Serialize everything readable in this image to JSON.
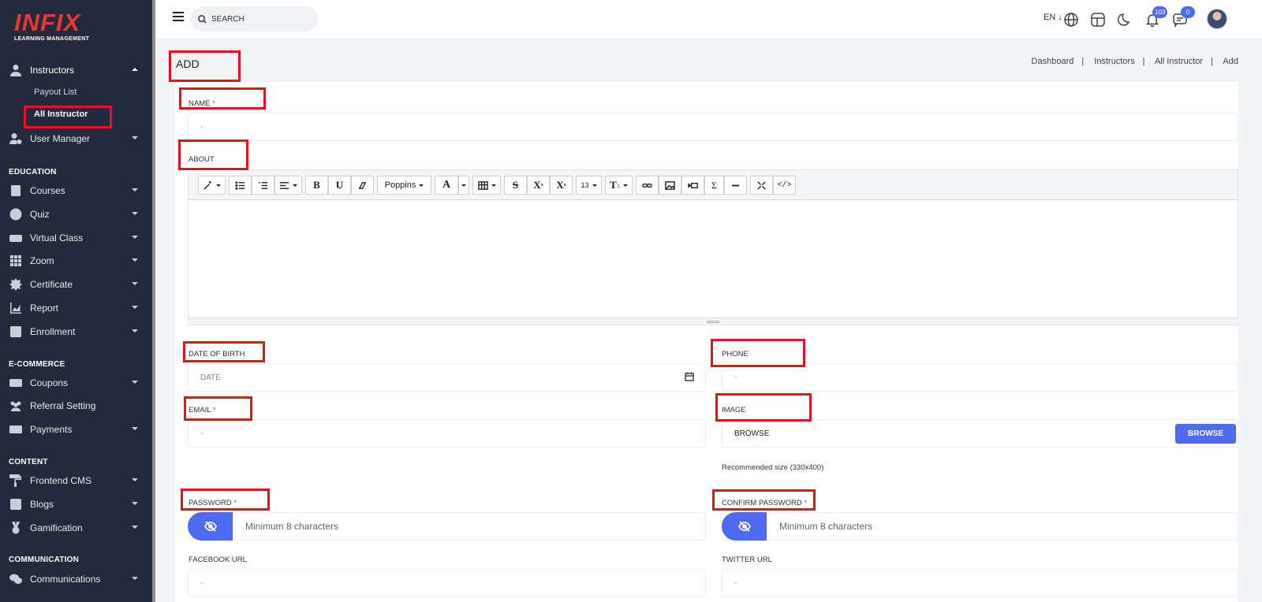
{
  "brand": {
    "logo": "INFIX",
    "subtitle": "LEARNING MANAGEMENT"
  },
  "sidebar": {
    "instructors": "Instructors",
    "payout_list": "Payout List",
    "all_instructor": "All Instructor",
    "user_manager": "User Manager",
    "education_head": "EDUCATION",
    "courses": "Courses",
    "quiz": "Quiz",
    "virtual_class": "Virtual Class",
    "zoom": "Zoom",
    "certificate": "Certificate",
    "report": "Report",
    "enrollment": "Enrollment",
    "ecommerce_head": "E-COMMERCE",
    "coupons": "Coupons",
    "referral": "Referral Setting",
    "payments": "Payments",
    "content_head": "CONTENT",
    "frontend_cms": "Frontend CMS",
    "blogs": "Blogs",
    "gamification": "Gamification",
    "communication_head": "COMMUNICATION",
    "communications": "Communications"
  },
  "topbar": {
    "search_placeholder": "SEARCH",
    "lang": "EN ↓",
    "notif_count": "103",
    "msg_count": "0"
  },
  "page": {
    "title": "ADD",
    "breadcrumb": [
      "Dashboard",
      "Instructors",
      "All Instructor",
      "Add"
    ]
  },
  "form": {
    "name_label": "NAME",
    "name_placeholder": "-",
    "about_label": "ABOUT",
    "font_name": "Poppins",
    "font_size": "13",
    "dob_label": "DATE OF BIRTH",
    "dob_placeholder": "DATE",
    "phone_label": "PHONE",
    "phone_placeholder": "-",
    "email_label": "EMAIL",
    "email_placeholder": "-",
    "image_label": "IMAGE",
    "image_placeholder": "BROWSE",
    "browse_button": "BROWSE",
    "image_hint": "Recommended size (330x400)",
    "password_label": "PASSWORD",
    "password_placeholder": "Minimum 8 characters",
    "confirm_label": "CONFIRM PASSWORD",
    "confirm_placeholder": "Minimum 8 characters",
    "facebook_label": "FACEBOOK URL",
    "facebook_placeholder": "-",
    "twitter_label": "TWITTER URL",
    "twitter_placeholder": "-",
    "required_mark": "*"
  },
  "colors": {
    "sidebar_bg": "#232a3b",
    "accent": "#4e6af0",
    "highlight": "#e8121b",
    "required": "#e53935"
  }
}
